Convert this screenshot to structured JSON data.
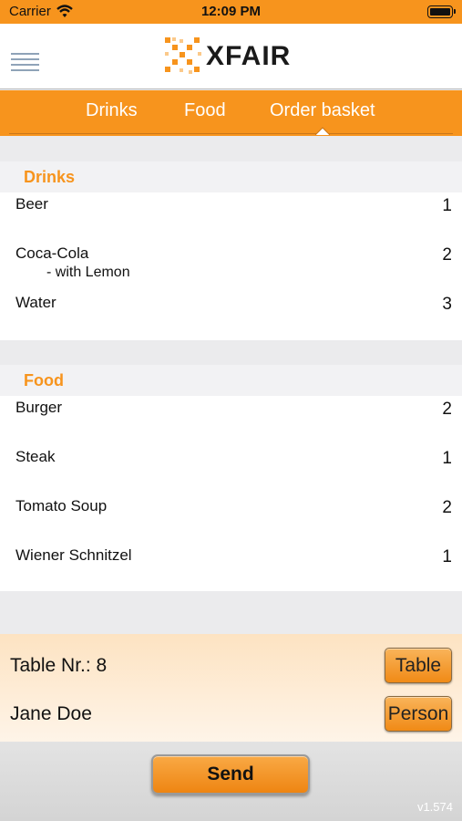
{
  "status_bar": {
    "carrier": "Carrier",
    "time": "12:09 PM"
  },
  "header": {
    "logo_text": "XFAIR"
  },
  "tabs": [
    {
      "label": "Drinks"
    },
    {
      "label": "Food"
    },
    {
      "label": "Order basket",
      "selected": true
    }
  ],
  "basket": {
    "drinks": {
      "title": "Drinks",
      "items": [
        {
          "name": "Beer",
          "qty": "1"
        },
        {
          "name": "Coca-Cola",
          "note": "- with Lemon",
          "qty": "2"
        },
        {
          "name": "Water",
          "qty": "3"
        }
      ]
    },
    "food": {
      "title": "Food",
      "items": [
        {
          "name": "Burger",
          "qty": "2"
        },
        {
          "name": "Steak",
          "qty": "1"
        },
        {
          "name": "Tomato Soup",
          "qty": "2"
        },
        {
          "name": "Wiener Schnitzel",
          "qty": "1"
        }
      ]
    }
  },
  "footer": {
    "table_label": "Table Nr.: 8",
    "table_button": "Table",
    "person_name": "Jane Doe",
    "person_button": "Person",
    "send_button": "Send",
    "version": "v1.574"
  },
  "colors": {
    "accent": "#f7941d",
    "background": "#ebebed"
  }
}
